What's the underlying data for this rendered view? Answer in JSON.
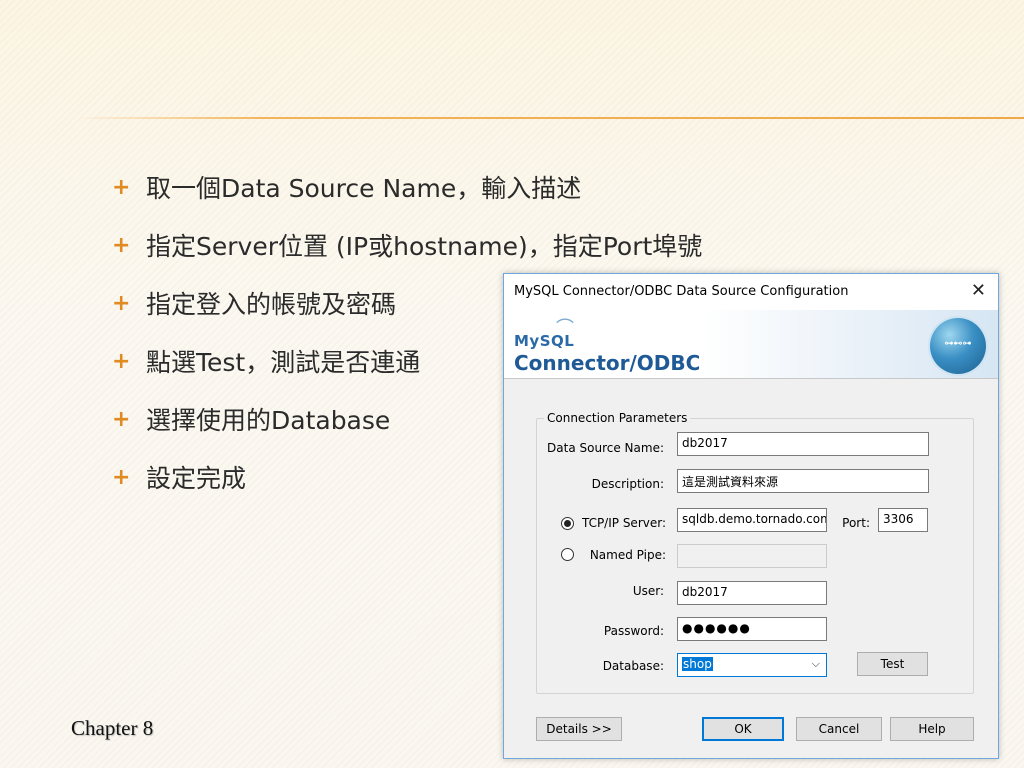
{
  "slide": {
    "bullets": [
      "取一個Data Source Name，輸入描述",
      "指定Server位置 (IP或hostname)，指定Port埠號",
      "指定登入的帳號及密碼",
      "點選Test，測試是否連通",
      "選擇使用的Database",
      "設定完成"
    ],
    "bullet_symbol": "+",
    "footer": "Chapter 8"
  },
  "dialog": {
    "title": "MySQL Connector/ODBC Data Source Configuration",
    "close_glyph": "✕",
    "logo": {
      "mysql": "MySQL",
      "product": "Connector/ODBC"
    },
    "group_title": "Connection Parameters",
    "labels": {
      "dsn": "Data Source Name:",
      "description": "Description:",
      "tcpip": "TCP/IP Server:",
      "port": "Port:",
      "named_pipe": "Named Pipe:",
      "user": "User:",
      "password": "Password:",
      "database": "Database:"
    },
    "values": {
      "dsn": "db2017",
      "description": "這是測試資料來源",
      "server": "sqldb.demo.tornado.com",
      "port": "3306",
      "named_pipe": "",
      "user": "db2017",
      "password": "●●●●●●",
      "database": "shop"
    },
    "connection_mode": "tcpip",
    "buttons": {
      "test": "Test",
      "details": "Details >>",
      "ok": "OK",
      "cancel": "Cancel",
      "help": "Help"
    },
    "colors": {
      "accent": "#0078d7",
      "logo_blue": "#1f5a96",
      "logo_orange": "#e38c1c"
    }
  }
}
